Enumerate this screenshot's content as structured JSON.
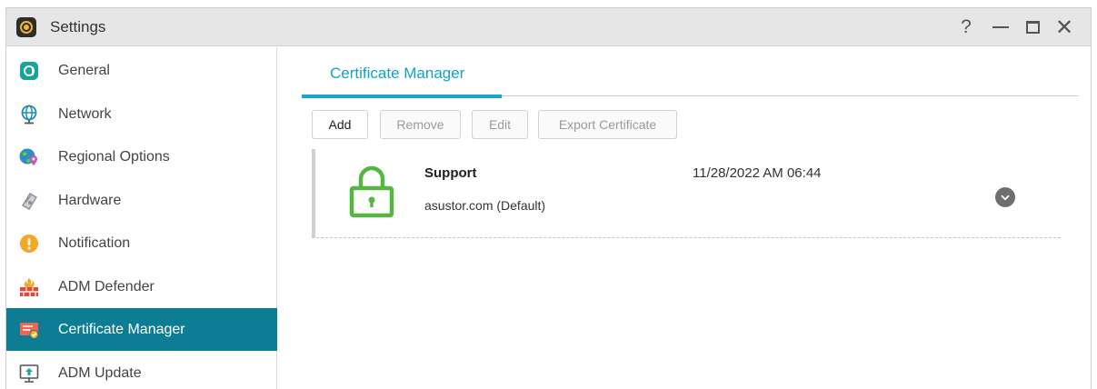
{
  "window": {
    "title": "Settings",
    "help_glyph": "?",
    "close_glyph": "✕"
  },
  "sidebar": {
    "items": [
      {
        "label": "General",
        "icon": "general-icon"
      },
      {
        "label": "Network",
        "icon": "globe-icon"
      },
      {
        "label": "Regional Options",
        "icon": "regional-globe-pin-icon"
      },
      {
        "label": "Hardware",
        "icon": "hardware-icon"
      },
      {
        "label": "Notification",
        "icon": "exclamation-icon"
      },
      {
        "label": "ADM Defender",
        "icon": "firewall-icon"
      },
      {
        "label": "Certificate Manager",
        "icon": "certificate-icon",
        "active": true
      },
      {
        "label": "ADM Update",
        "icon": "update-icon"
      }
    ]
  },
  "main": {
    "tabs": [
      {
        "label": "Certificate Manager",
        "active": true
      }
    ],
    "toolbar": {
      "add": "Add",
      "remove": "Remove",
      "edit": "Edit",
      "export": "Export Certificate"
    },
    "certificates": [
      {
        "name": "Support",
        "domain": "asustor.com (Default)",
        "date": "11/28/2022 AM 06:44",
        "icon": "lock-icon"
      }
    ]
  },
  "colors": {
    "accent": "#17a9c9",
    "sidebar_active": "#0c7d95",
    "lock_green": "#55b83e"
  }
}
